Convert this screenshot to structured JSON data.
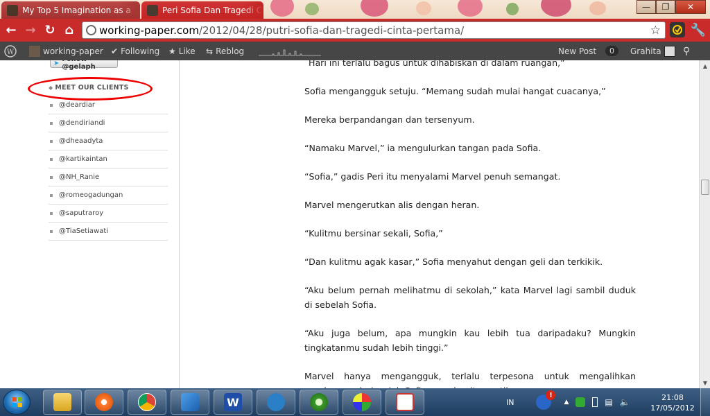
{
  "browser": {
    "tabs": [
      {
        "title": "My Top 5 Imagination as a",
        "active": false
      },
      {
        "title": "Peri Sofia Dan Tragedi Cinta",
        "active": true
      }
    ],
    "url_host": "working-paper.com",
    "url_path": "/2012/04/28/putri-sofia-dan-tragedi-cinta-pertama/"
  },
  "wpbar": {
    "site": "working-paper",
    "following": "Following",
    "like": "Like",
    "reblog": "Reblog",
    "new_post": "New Post",
    "count": "0",
    "user": "Grahita"
  },
  "sidebar": {
    "follow_button": "Follow @gelaph",
    "clients_title": "MEET OUR CLIENTS",
    "clients": [
      "@deardiar",
      "@dendiriandi",
      "@dheaadyta",
      "@kartikaintan",
      "@NH_Ranie",
      "@romeogadungan",
      "@saputraroy",
      "@TiaSetiawati"
    ]
  },
  "article": {
    "paragraphs": [
      "Hari ini terlalu bagus untuk dihabiskan di dalam ruangan,”",
      "Sofia mengangguk setuju. “Memang sudah mulai hangat cuacanya,”",
      "Mereka berpandangan dan tersenyum.",
      "“Namaku Marvel,” ia mengulurkan tangan pada Sofia.",
      "“Sofia,” gadis Peri itu menyalami Marvel penuh semangat.",
      "Marvel mengerutkan alis dengan heran.",
      "“Kulitmu bersinar sekali, Sofia,”",
      "“Dan kulitmu agak kasar,” Sofia menyahut dengan geli dan terkikik.",
      "“Aku belum pernah melihatmu di sekolah,” kata Marvel lagi sambil duduk di sebelah Sofia.",
      "“Aku juga belum, apa mungkin kau lebih tua daripadaku? Mungkin tingkatanmu sudah lebih tinggi.”",
      "Marvel hanya mengangguk, terlalu terpesona untuk mengalihkan pandangan dari wajah Sofia yang begitu cantik."
    ]
  },
  "taskbar": {
    "language": "IN",
    "time": "21:08",
    "date": "17/05/2012"
  },
  "colors": {
    "chrome_red": "#c92a2a",
    "wpbar": "#464646",
    "highlight": "#e00000",
    "taskbar": "#2c4d72"
  }
}
